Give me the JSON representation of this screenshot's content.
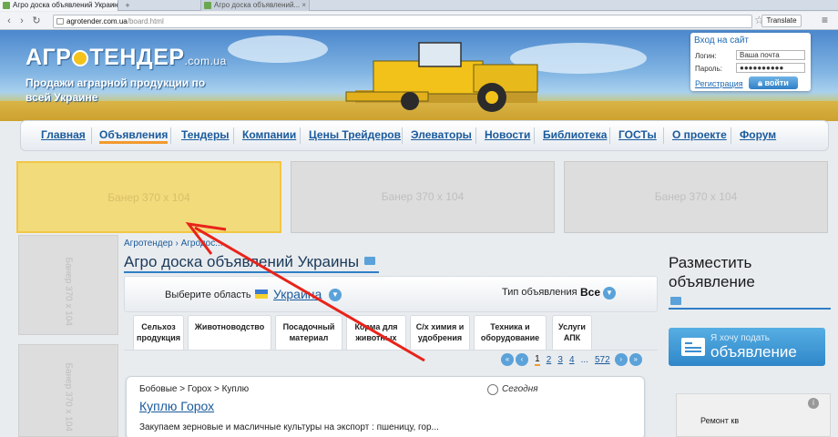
{
  "browser": {
    "active_tab_title": "Агро доска объявлений Украины на А...",
    "inactive_tab_title": "Агро доска объявлений...",
    "url_host": "agrotender.com.ua",
    "url_path": "/board.html",
    "translate_label": "Translate"
  },
  "header": {
    "logo_left": "АГР",
    "logo_right": "ТЕНДЕР",
    "logo_tld": ".com.ua",
    "tagline": "Продажи аграрной продукции по всей Украине"
  },
  "login": {
    "title": "Вход на сайт",
    "login_label": "Логин:",
    "login_value": "Ваша почта",
    "password_label": "Пароль:",
    "password_value": "●●●●●●●●●●",
    "register_label": "Регистрация",
    "submit_label": "войти"
  },
  "nav": {
    "items": [
      "Главная",
      "Объявления",
      "Тендеры",
      "Компании",
      "Цены Трейдеров",
      "Элеваторы",
      "Новости",
      "Библиотека",
      "ГОСТы",
      "О проекте",
      "Форум"
    ]
  },
  "banners": {
    "wide": "Банер 370 x 104",
    "side": "Банер 370 x 104"
  },
  "content": {
    "breadcrumb": "Агротендер › Агродос...",
    "title": "Агро доска объявлений Украины",
    "region_label": "Выберите область",
    "region_value": "Украина",
    "type_label": "Тип объявления",
    "type_value": "Все",
    "categories": [
      [
        "Сельхоз",
        "продукция"
      ],
      [
        "Животноводство",
        ""
      ],
      [
        "Посадочный",
        "материал"
      ],
      [
        "Корма для",
        "животных"
      ],
      [
        "С/х химия и",
        "удобрения"
      ],
      [
        "Техника и",
        "оборудование"
      ],
      [
        "Услуги",
        "АПК"
      ]
    ],
    "pager": {
      "pages": [
        "1",
        "2",
        "3",
        "4",
        "...",
        "572"
      ]
    },
    "listing": {
      "crumb": "Бобовые > Горох > Куплю",
      "title": "Куплю Горох",
      "date": "Сегодня",
      "text": "Закупаем зерновые и масличные культуры на экспорт : пшеницу, гор..."
    }
  },
  "right": {
    "title": "Разместить объявление",
    "post_small": "Я хочу подать",
    "post_big": "объявление",
    "ad_label": "Ремонт кв",
    "ad_info": "i"
  },
  "colors": {
    "link": "#1a5a9c",
    "accent_orange": "#f29a2e",
    "button_blue": "#2f87c9",
    "highlight_banner": "#f2db7b",
    "annotation_red": "#e8231a"
  }
}
